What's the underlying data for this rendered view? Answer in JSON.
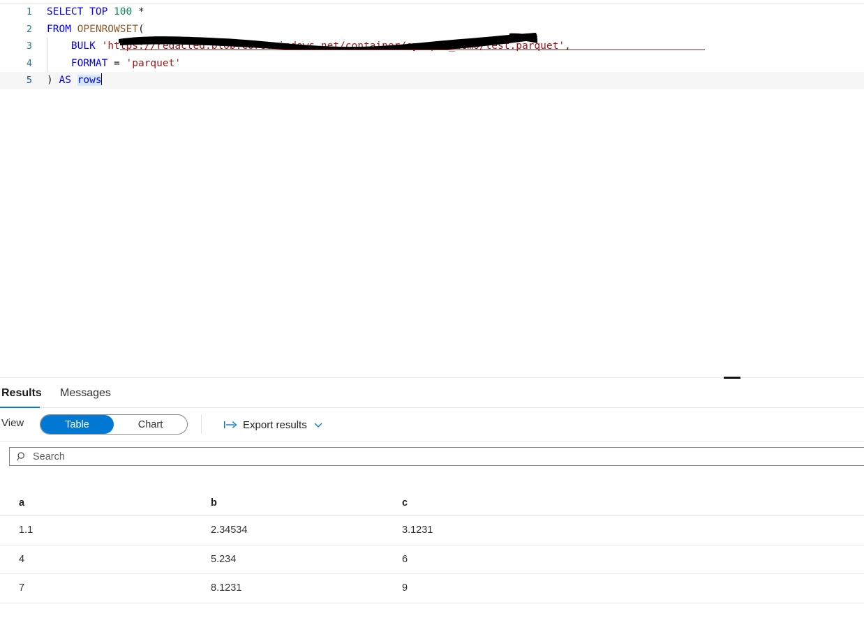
{
  "editor": {
    "lines": [
      {
        "number": "1",
        "tokens": [
          {
            "text": "SELECT TOP ",
            "cls": "kw"
          },
          {
            "text": "100",
            "cls": "num"
          },
          {
            "text": " *",
            "cls": "plain"
          }
        ]
      },
      {
        "number": "2",
        "tokens": [
          {
            "text": "FROM ",
            "cls": "kw"
          },
          {
            "text": "OPENROWSET",
            "cls": "fn"
          },
          {
            "text": "(",
            "cls": "plain"
          }
        ]
      },
      {
        "number": "3",
        "tokens": [
          {
            "text": "    BULK ",
            "cls": "kw"
          },
          {
            "text": "'",
            "cls": "str"
          },
          {
            "text": "https://redacted.blob.core.windows.net/container",
            "cls": "str redacted-text"
          },
          {
            "text": "/synapse_demo/test.parquet'",
            "cls": "str"
          },
          {
            "text": ",",
            "cls": "plain"
          }
        ]
      },
      {
        "number": "4",
        "tokens": [
          {
            "text": "    FORMAT ",
            "cls": "kw"
          },
          {
            "text": "= ",
            "cls": "plain"
          },
          {
            "text": "'parquet'",
            "cls": "str"
          }
        ]
      },
      {
        "number": "5",
        "tokens": [
          {
            "text": ") ",
            "cls": "plain"
          },
          {
            "text": "AS ",
            "cls": "kw"
          },
          {
            "text": "rows",
            "cls": "kw sel-word"
          }
        ]
      }
    ]
  },
  "results": {
    "tabs": [
      {
        "id": "results",
        "label": "Results",
        "active": true
      },
      {
        "id": "messages",
        "label": "Messages",
        "active": false
      }
    ],
    "toolbar": {
      "view_label": "View",
      "view_options": [
        {
          "label": "Table",
          "selected": true
        },
        {
          "label": "Chart",
          "selected": false
        }
      ],
      "export_label": "Export results",
      "export_icon": "export-arrow-icon",
      "export_chevron": "chevron-down-icon"
    },
    "search": {
      "placeholder": "Search",
      "value": "",
      "icon": "search-icon"
    },
    "table": {
      "columns": [
        "a",
        "b",
        "c"
      ],
      "rows": [
        [
          "1.1",
          "2.34534",
          "3.1231"
        ],
        [
          "4",
          "5.234",
          "6"
        ],
        [
          "7",
          "8.1231",
          "9"
        ]
      ]
    }
  },
  "colors": {
    "accent": "#0078d4",
    "keyword": "#0000ff",
    "number": "#098658",
    "function": "#8b5a2b",
    "string": "#a31515",
    "line_number": "#2b7a8c",
    "redaction": "#000000"
  }
}
